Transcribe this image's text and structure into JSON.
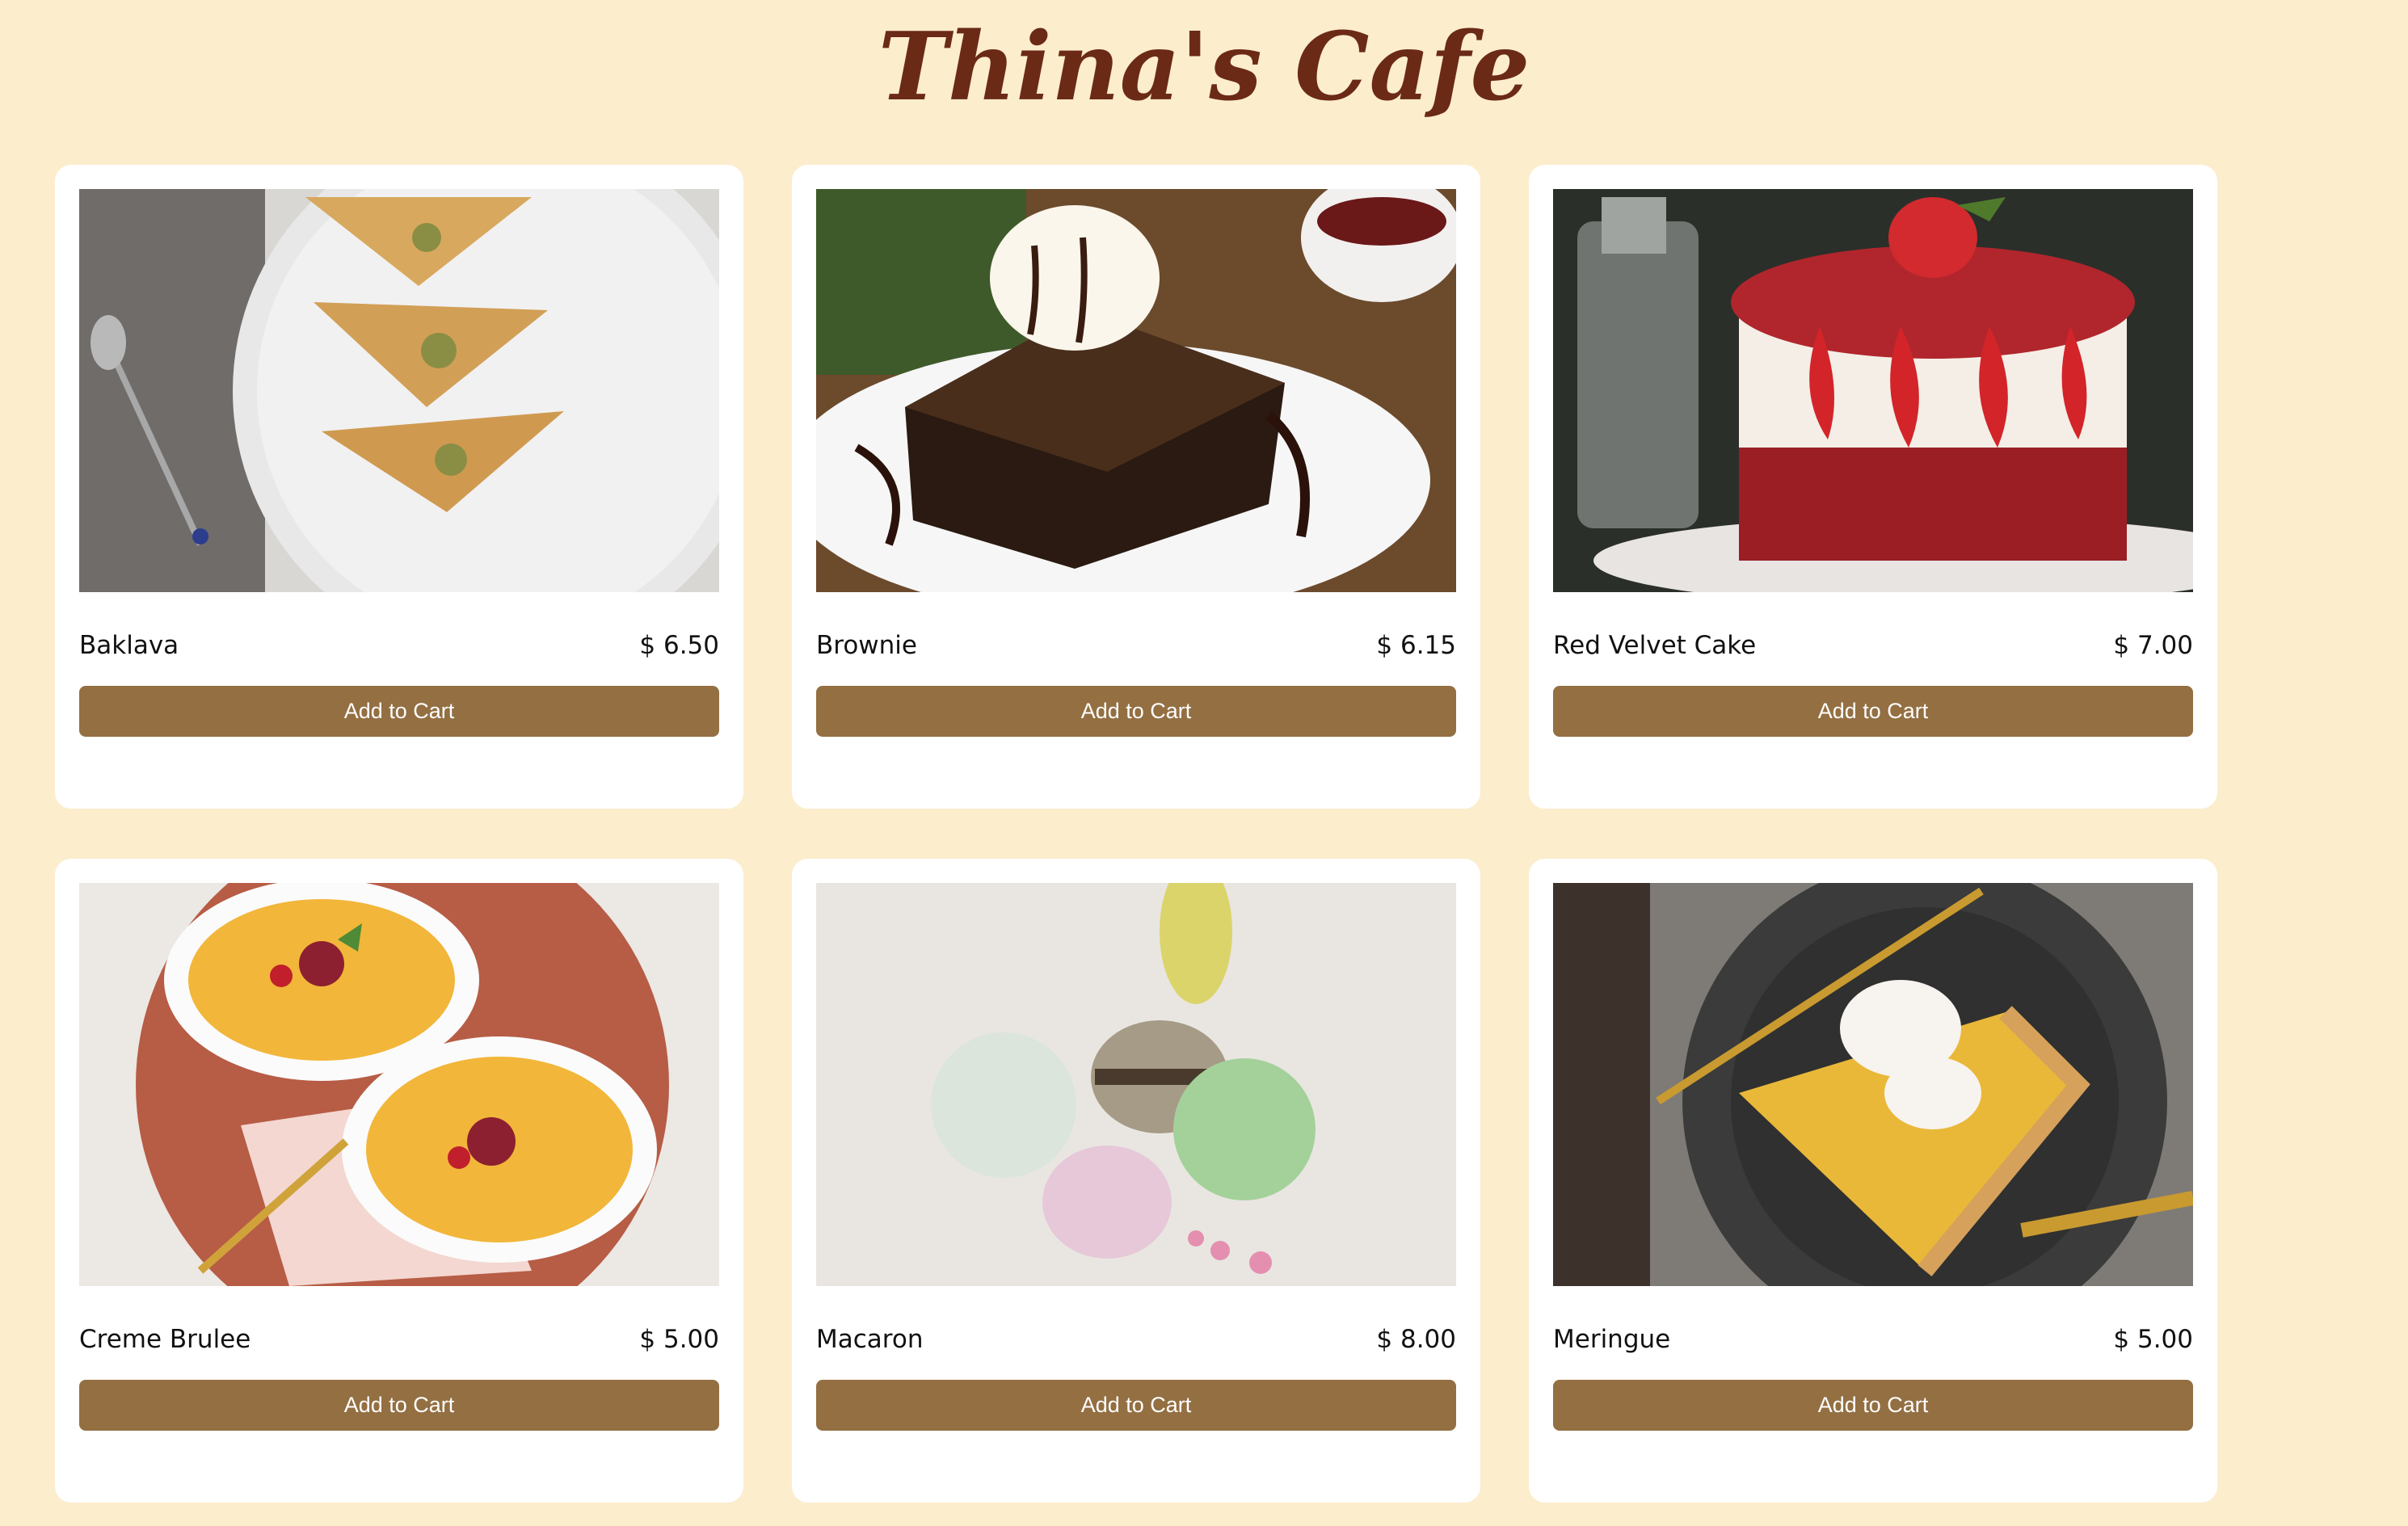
{
  "header": {
    "title": "Thina's Cafe"
  },
  "theme": {
    "background": "#fcedcd",
    "card": "#ffffff",
    "title_color": "#6b2a16",
    "button_color": "#936f42",
    "button_text": "#ffffff"
  },
  "products": [
    {
      "name": "Baklava",
      "price": "$ 6.50",
      "button_label": "Add to Cart",
      "image": "baklava-photo"
    },
    {
      "name": "Brownie",
      "price": "$ 6.15",
      "button_label": "Add to Cart",
      "image": "brownie-photo"
    },
    {
      "name": "Red Velvet Cake",
      "price": "$ 7.00",
      "button_label": "Add to Cart",
      "image": "red-velvet-cake-photo"
    },
    {
      "name": "Creme Brulee",
      "price": "$ 5.00",
      "button_label": "Add to Cart",
      "image": "creme-brulee-photo"
    },
    {
      "name": "Macaron",
      "price": "$ 8.00",
      "button_label": "Add to Cart",
      "image": "macaron-photo"
    },
    {
      "name": "Meringue",
      "price": "$ 5.00",
      "button_label": "Add to Cart",
      "image": "meringue-photo"
    }
  ]
}
